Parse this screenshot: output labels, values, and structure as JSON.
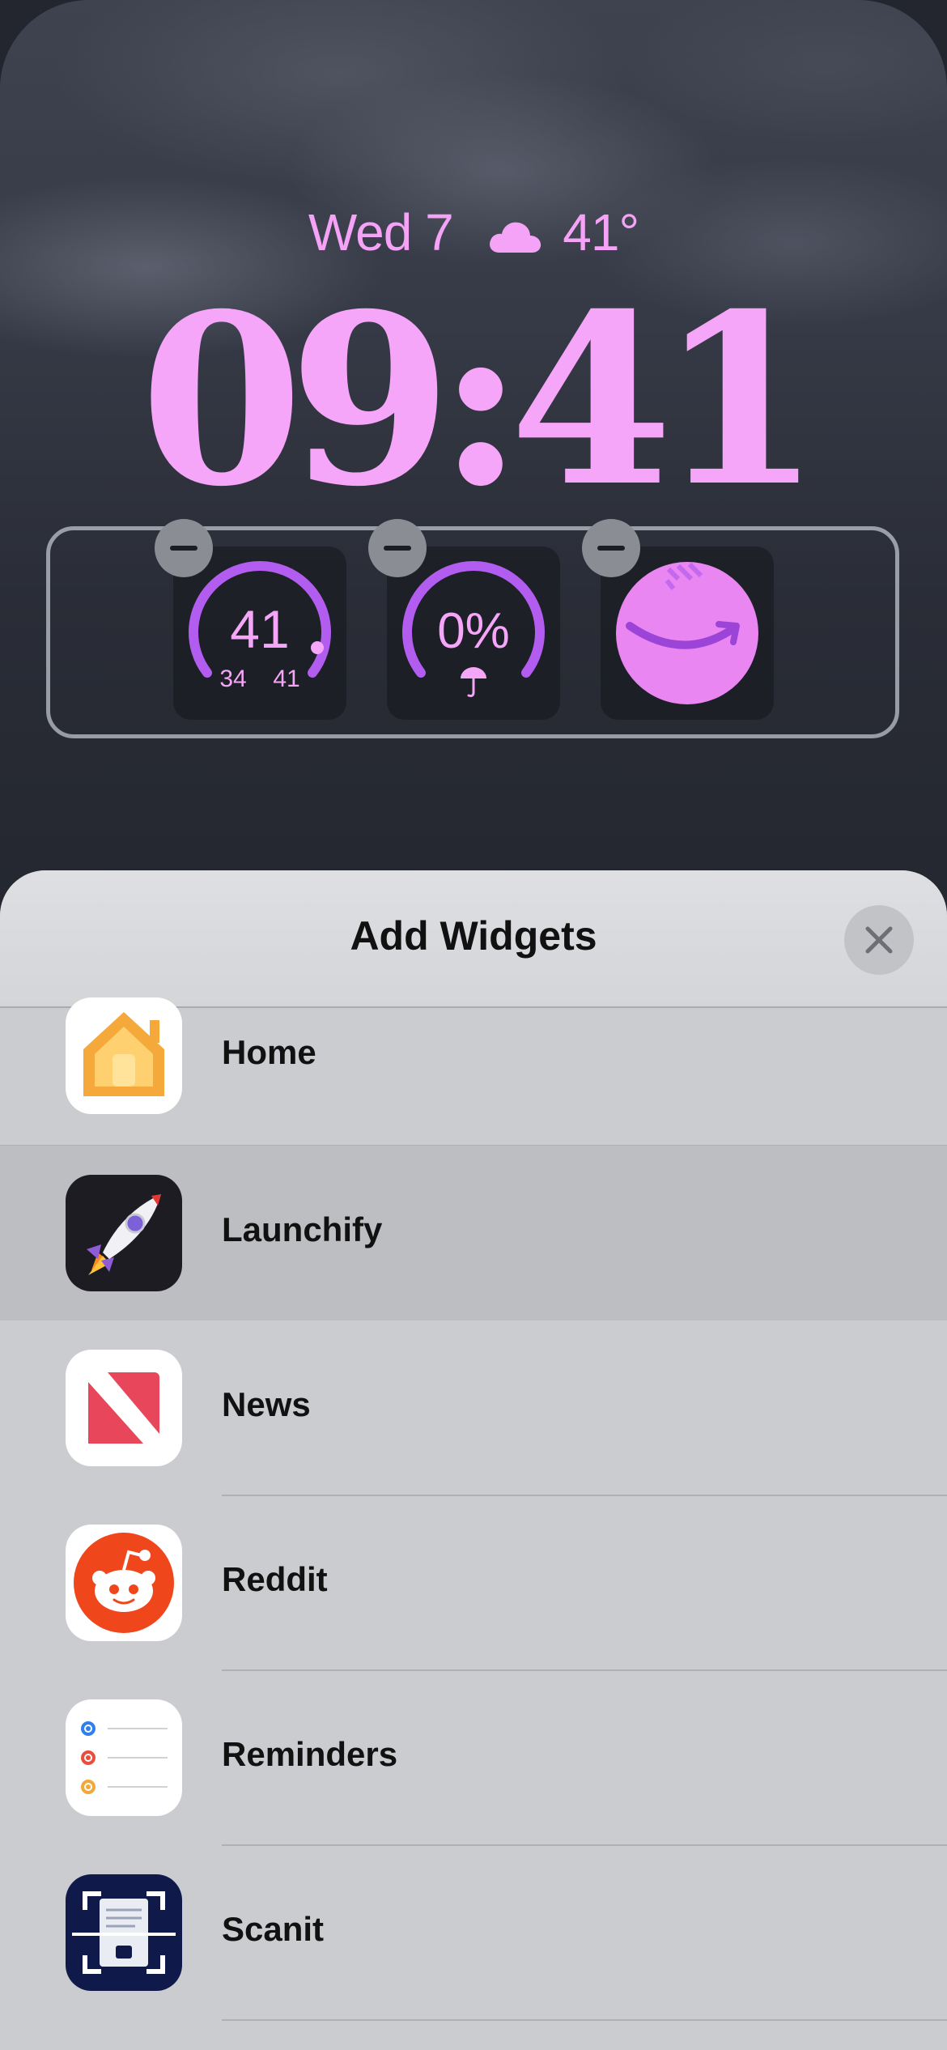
{
  "lockscreen": {
    "date": "Wed 7",
    "weather_icon": "cloud-icon",
    "temperature": "41°",
    "time": "09:41",
    "colors": {
      "accent": "#f6a6f8",
      "ring": "#b35df0"
    }
  },
  "widgets": [
    {
      "name": "temperature-gauge",
      "value": "41",
      "low": "34",
      "high": "41",
      "level": 0.9
    },
    {
      "name": "precipitation-gauge",
      "value": "0%",
      "icon": "umbrella-icon",
      "level": 0.0
    },
    {
      "name": "amazon-widget",
      "icon": "amazon-smile-icon"
    }
  ],
  "sheet": {
    "title": "Add Widgets",
    "close_icon": "close-icon",
    "apps": [
      {
        "label": "Home",
        "icon": "home-icon"
      },
      {
        "label": "Launchify",
        "icon": "rocket-icon"
      },
      {
        "label": "News",
        "icon": "news-icon"
      },
      {
        "label": "Reddit",
        "icon": "reddit-icon"
      },
      {
        "label": "Reminders",
        "icon": "reminders-icon"
      },
      {
        "label": "Scanit",
        "icon": "scanit-icon"
      }
    ]
  }
}
